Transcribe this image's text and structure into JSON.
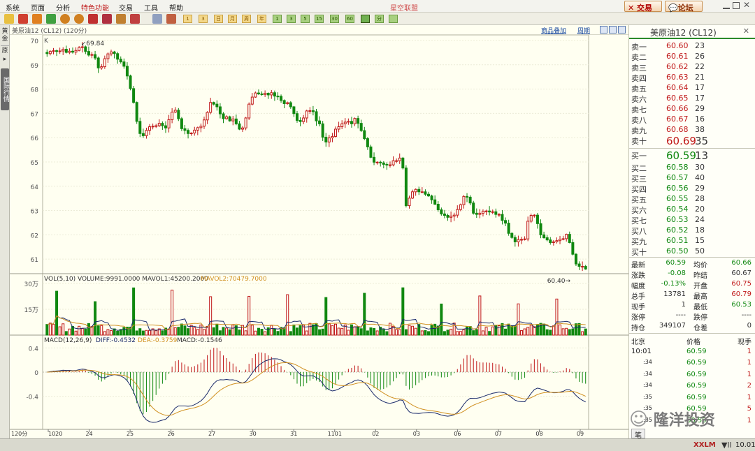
{
  "menu": {
    "items": [
      "系统",
      "页面",
      "分析",
      "特色功能",
      "交易",
      "工具",
      "帮助"
    ],
    "title": "星空联盟",
    "trade": "交易",
    "forum": "论坛"
  },
  "toolbar": {
    "periods": [
      "1",
      "3",
      "5",
      "15",
      "30",
      "60"
    ],
    "day": "日",
    "week": "周",
    "month": "月",
    "year": "年",
    "min": "分"
  },
  "sidetabs": {
    "tab1": "黄金",
    "tab2": "原",
    "tab3": "国际行情",
    "arrow": "▸"
  },
  "chart": {
    "header": "美原油12 (CL12) (120分)",
    "overlay": "商品叠加",
    "period": "周期",
    "k_label": "K",
    "high_label": "69.84",
    "low_label": "60.40",
    "vol_label": "VOL(5,10) VOLUME:9991.0000 MAVOL1:45200.2000",
    "vol_ma2": "MAVOL2:70479.7000",
    "macd_label": "MACD(12,26,9)",
    "macd_diff": "DIFF:-0.4532",
    "macd_dea": "DEA:-0.3759",
    "macd_val": "MACD:-0.1546",
    "period_label": "120分"
  },
  "chart_data": [
    {
      "type": "candlestick",
      "title": "美原油12 (CL12)",
      "ylim": [
        60.4,
        70.0
      ],
      "yticks": [
        "70",
        "69",
        "68",
        "67",
        "66",
        "65",
        "64",
        "63",
        "62",
        "61"
      ],
      "xticks": [
        "1020",
        "24",
        "25",
        "26",
        "27",
        "30",
        "31",
        "1101",
        "02",
        "03",
        "06",
        "07",
        "08",
        "09"
      ],
      "close": [
        69.46,
        69.55,
        69.58,
        69.55,
        69.57,
        69.64,
        69.51,
        69.56,
        69.52,
        69.59,
        69.71,
        69.74,
        69.55,
        69.4,
        69.42,
        69.28,
        68.87,
        68.92,
        69.25,
        69.45,
        69.53,
        69.46,
        69.23,
        69.12,
        68.94,
        68.54,
        68.02,
        67.45,
        66.67,
        66.17,
        66.08,
        66.3,
        66.45,
        66.47,
        66.49,
        66.59,
        66.49,
        66.4,
        66.74,
        67.05,
        67.13,
        66.78,
        66.37,
        66.3,
        66.17,
        66.19,
        66.31,
        66.41,
        66.47,
        66.73,
        67.04,
        67.45,
        67.38,
        67.27,
        66.98,
        66.78,
        66.86,
        66.69,
        66.77,
        66.57,
        66.35,
        66.4,
        66.81,
        67.38,
        67.67,
        67.84,
        67.8,
        67.78,
        67.83,
        67.76,
        67.85,
        67.71,
        67.7,
        67.53,
        67.4,
        67.44,
        67.27,
        66.99,
        66.71,
        66.66,
        66.81,
        67.1,
        67.11,
        67.07,
        66.69,
        66.57,
        66.02,
        65.82,
        65.99,
        66.05,
        66.35,
        66.45,
        66.57,
        66.64,
        66.67,
        66.57,
        66.79,
        66.59,
        66.29,
        65.96,
        65.62,
        65.19,
        64.99,
        64.99,
        64.96,
        64.9,
        64.87,
        64.88,
        65.05,
        65.05,
        65.16,
        64.75,
        63.2,
        63.51,
        63.77,
        63.87,
        63.77,
        63.77,
        63.67,
        63.6,
        63.44,
        63.26,
        63.03,
        62.86,
        62.8,
        62.72,
        62.77,
        62.81,
        63.04,
        63.24,
        63.58,
        63.55,
        63.31,
        62.89,
        62.84,
        62.89,
        62.97,
        62.98,
        62.94,
        62.95,
        62.84,
        62.84,
        62.59,
        62.48,
        62.06,
        61.89,
        61.71,
        61.8,
        61.81,
        61.83,
        62.56,
        62.8,
        62.81,
        62.46,
        62.0,
        61.88,
        61.79,
        61.68,
        61.71,
        61.76,
        61.82,
        61.84,
        62.02,
        61.68,
        61.2,
        60.8,
        60.7,
        60.7,
        60.59
      ]
    },
    {
      "type": "bar",
      "title": "VOL(5,10)",
      "ylim": [
        0,
        300000
      ],
      "yticks": [
        "30万",
        "15万"
      ],
      "note": "volume bars with moving averages MAVOL1 45200.2000, MAVOL2 70479.7000"
    },
    {
      "type": "bar",
      "title": "MACD(12,26,9)",
      "ylim": [
        -0.9,
        0.45
      ],
      "yticks": [
        "0.4",
        "0",
        "-0.4"
      ],
      "series": [
        {
          "name": "DIFF",
          "last": -0.4532
        },
        {
          "name": "DEA",
          "last": -0.3759
        },
        {
          "name": "MACD",
          "last": -0.1546
        }
      ]
    }
  ],
  "quote": {
    "title": "美原油12 (CL12)",
    "asks": [
      {
        "label": "卖十",
        "price": "60.69",
        "vol": "35"
      },
      {
        "label": "卖九",
        "price": "60.68",
        "vol": "38"
      },
      {
        "label": "卖八",
        "price": "60.67",
        "vol": "16"
      },
      {
        "label": "卖七",
        "price": "60.66",
        "vol": "29"
      },
      {
        "label": "卖六",
        "price": "60.65",
        "vol": "17"
      },
      {
        "label": "卖五",
        "price": "60.64",
        "vol": "17"
      },
      {
        "label": "卖四",
        "price": "60.63",
        "vol": "21"
      },
      {
        "label": "卖三",
        "price": "60.62",
        "vol": "22"
      },
      {
        "label": "卖二",
        "price": "60.61",
        "vol": "26"
      },
      {
        "label": "卖一",
        "price": "60.60",
        "vol": "23"
      }
    ],
    "bids": [
      {
        "label": "买一",
        "price": "60.59",
        "vol": "13"
      },
      {
        "label": "买二",
        "price": "60.58",
        "vol": "30"
      },
      {
        "label": "买三",
        "price": "60.57",
        "vol": "40"
      },
      {
        "label": "买四",
        "price": "60.56",
        "vol": "29"
      },
      {
        "label": "买五",
        "price": "60.55",
        "vol": "28"
      },
      {
        "label": "买六",
        "price": "60.54",
        "vol": "20"
      },
      {
        "label": "买七",
        "price": "60.53",
        "vol": "24"
      },
      {
        "label": "买八",
        "price": "60.52",
        "vol": "18"
      },
      {
        "label": "买九",
        "price": "60.51",
        "vol": "15"
      },
      {
        "label": "买十",
        "price": "60.50",
        "vol": "50"
      }
    ],
    "stats": [
      {
        "l1": "最新",
        "v1": "60.59",
        "l2": "均价",
        "v2": "60.66",
        "c1": "#108810",
        "c2": "#108810"
      },
      {
        "l1": "涨跌",
        "v1": "-0.08",
        "l2": "昨结",
        "v2": "60.67",
        "c1": "#108810",
        "c2": "#333333"
      },
      {
        "l1": "幅度",
        "v1": "-0.13%",
        "l2": "开盘",
        "v2": "60.75",
        "c1": "#108810",
        "c2": "#c01818"
      },
      {
        "l1": "总手",
        "v1": "13781",
        "l2": "最高",
        "v2": "60.79",
        "c1": "#333333",
        "c2": "#c01818"
      },
      {
        "l1": "现手",
        "v1": "1",
        "l2": "最低",
        "v2": "60.53",
        "c1": "#333333",
        "c2": "#108810"
      },
      {
        "l1": "涨停",
        "v1": "----",
        "l2": "跌停",
        "v2": "----",
        "c1": "#333333",
        "c2": "#333333"
      },
      {
        "l1": "持仓",
        "v1": "349107",
        "l2": "仓差",
        "v2": "0",
        "c1": "#333333",
        "c2": "#333333"
      }
    ],
    "ticks_header": {
      "a": "北京",
      "b": "价格",
      "c": "现手"
    },
    "ticks": [
      {
        "t": "10:01",
        "p": "60.59",
        "v": "1"
      },
      {
        "t": ":34",
        "p": "60.59",
        "v": "1"
      },
      {
        "t": ":34",
        "p": "60.59",
        "v": "1"
      },
      {
        "t": ":34",
        "p": "60.59",
        "v": "2"
      },
      {
        "t": ":35",
        "p": "60.59",
        "v": "1"
      },
      {
        "t": ":35",
        "p": "60.59",
        "v": "5"
      },
      {
        "t": ":35",
        "p": "60.59",
        "v": "1"
      }
    ],
    "bottom_tab": "笔"
  },
  "watermark": "隆洋投资",
  "status": {
    "brand": "XXLM",
    "time": "10.01"
  },
  "colors": {
    "up": "#c01818",
    "down": "#108810",
    "chart_bg": "#fffff1",
    "ma1": "#1a2a6a",
    "ma2": "#d09020"
  }
}
